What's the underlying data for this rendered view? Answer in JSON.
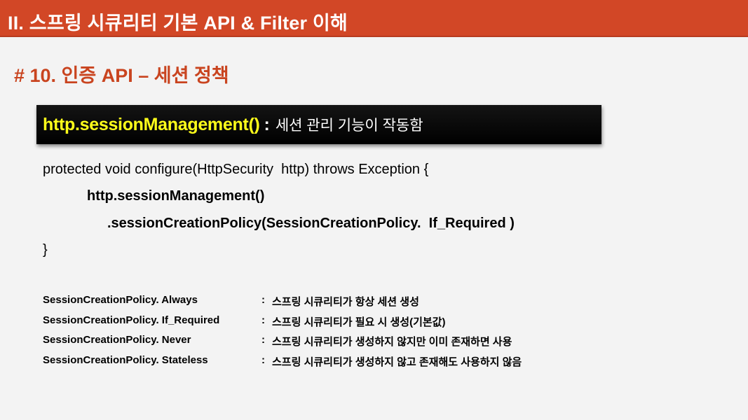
{
  "header": {
    "title": "II. 스프링 시큐리티 기본 API & Filter 이해"
  },
  "section": {
    "title": "# 10. 인증 API – 세션 정책"
  },
  "highlight": {
    "method": "http.sessionManagement()",
    "separator": ":",
    "description": "세션 관리 기능이 작동함"
  },
  "code": {
    "line1": "protected void configure(HttpSecurity  http) throws Exception {",
    "line2": "http.sessionManagement()",
    "line3": ".sessionCreationPolicy(SessionCreationPolicy.  If_Required )",
    "line4": "}"
  },
  "policies": [
    {
      "name": "SessionCreationPolicy. Always",
      "colon": ":",
      "description": "스프링 시큐리티가 항상 세션 생성"
    },
    {
      "name": "SessionCreationPolicy. If_Required",
      "colon": ":",
      "description": "스프링 시큐리티가 필요 시 생성(기본값)"
    },
    {
      "name": "SessionCreationPolicy. Never",
      "colon": ":",
      "description": "스프링 시큐리티가 생성하지 않지만 이미 존재하면 사용"
    },
    {
      "name": "SessionCreationPolicy. Stateless",
      "colon": ":",
      "description": "스프링 시큐리티가 생성하지 않고 존재해도 사용하지 않음"
    }
  ],
  "colors": {
    "header_background": "#d24726",
    "section_title": "#c9441f",
    "highlight_method": "#ffff1a",
    "highlight_background": "#000000",
    "slide_background": "#f3f3f3"
  }
}
